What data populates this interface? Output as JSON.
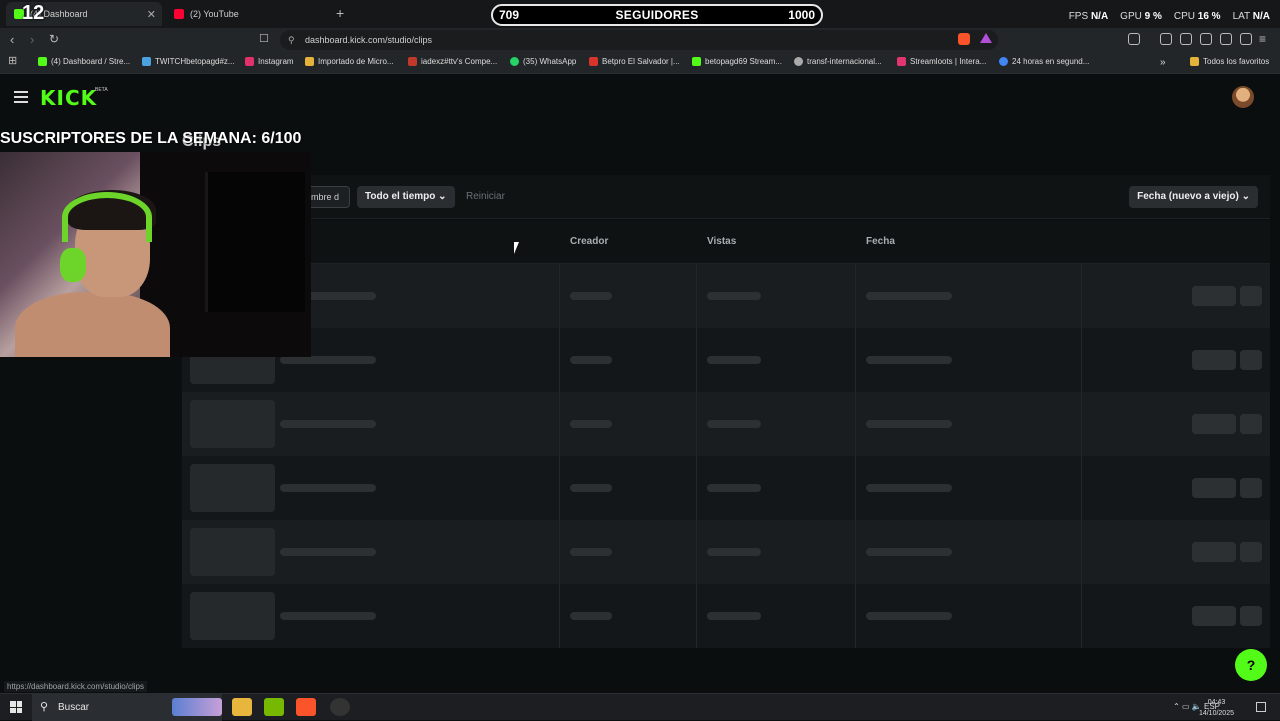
{
  "browser": {
    "tabs": [
      {
        "label": "(4) Dashboard",
        "active": true
      },
      {
        "label": "(2) YouTube",
        "active": false
      }
    ],
    "url": "dashboard.kick.com/studio/clips",
    "bookmarks": [
      "(4) Dashboard / Stre...",
      "TWITCHbetopagd#z...",
      "Instagram",
      "Importado de Micro...",
      "iadexz#ttv's Compe...",
      "(35) WhatsApp",
      "Betpro El Salvador |...",
      "betopagd69 Stream...",
      "transf-internacional...",
      "Streamloots | Intera...",
      "24 horas en segund...",
      "Todos los favoritos"
    ]
  },
  "stream_overlay": {
    "tab_count": "12",
    "followers_current": "709",
    "followers_label": "SEGUIDORES",
    "followers_goal": "1000",
    "subs_text": "SUSCRIPTORES DE LA SEMANA: 6/100",
    "perf": {
      "fps_label": "FPS",
      "fps": "N/A",
      "gpu_label": "GPU",
      "gpu": "9 %",
      "cpu_label": "CPU",
      "cpu": "16 %",
      "lat_label": "LAT",
      "lat": "N/A"
    }
  },
  "kick": {
    "logo": "KICK",
    "beta": "BETA",
    "page_title": "Clips",
    "filters": {
      "name_value": "mbre d",
      "time_range": "Todo el tiempo",
      "reset": "Reiniciar",
      "sort": "Fecha (nuevo a viejo)"
    },
    "columns": [
      "Creador",
      "Vistas",
      "Fecha"
    ],
    "loading_rows": 6
  },
  "status_url": "https://dashboard.kick.com/studio/clips",
  "taskbar": {
    "search": "Buscar",
    "lang": "ESP",
    "time": "04:43",
    "date": "14/10/2025"
  },
  "colors": {
    "kick_green": "#53fc18",
    "bg": "#0b0e0f"
  }
}
